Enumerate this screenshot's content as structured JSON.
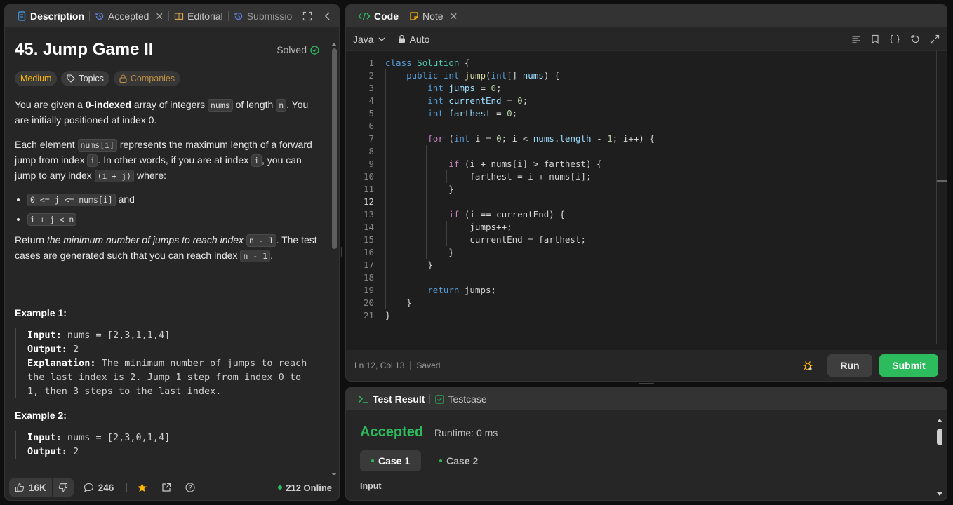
{
  "left_panel": {
    "tabs": [
      {
        "label": "Description",
        "icon": "document-icon",
        "active": true
      },
      {
        "label": "Accepted",
        "icon": "history-icon"
      },
      {
        "label": "Editorial",
        "icon": "book-icon"
      },
      {
        "label": "Submissio",
        "icon": "history-icon"
      }
    ],
    "problem": {
      "title": "45. Jump Game II",
      "status": "Solved",
      "difficulty": "Medium",
      "topics_label": "Topics",
      "companies_label": "Companies"
    },
    "description": {
      "p1_a": "You are given a ",
      "p1_bold": "0-indexed",
      "p1_b": " array of integers ",
      "p1_code1": "nums",
      "p1_c": " of length ",
      "p1_code2": "n",
      "p1_d": ". You are initially positioned at index 0.",
      "p2_a": "Each element ",
      "p2_code1": "nums[i]",
      "p2_b": " represents the maximum length of a forward jump from index ",
      "p2_code2": "i",
      "p2_c": ". In other words, if you are at index ",
      "p2_code3": "i",
      "p2_d": ", you can jump to any index ",
      "p2_code4": "(i + j)",
      "p2_e": " where:",
      "bullet1_code": "0 <= j <= nums[i]",
      "bullet1_text": " and",
      "bullet2_code": "i + j < n",
      "p3_a": "Return ",
      "p3_italic": "the minimum number of jumps to reach index",
      "p3_code1": "n - 1",
      "p3_b": ". The test cases are generated such that you can reach index ",
      "p3_code2": "n - 1",
      "p3_c": "."
    },
    "examples": [
      {
        "title": "Example 1:",
        "input_label": "Input:",
        "input": "nums = [2,3,1,1,4]",
        "output_label": "Output:",
        "output": "2",
        "explanation_label": "Explanation:",
        "explanation": "The minimum number of jumps to reach the last index is 2. Jump 1 step from index 0 to 1, then 3 steps to the last index."
      },
      {
        "title": "Example 2:",
        "input_label": "Input:",
        "input": "nums = [2,3,0,1,4]",
        "output_label": "Output:",
        "output": "2"
      }
    ],
    "footer": {
      "likes": "16K",
      "comments": "246",
      "online": "212 Online"
    }
  },
  "code_panel": {
    "tabs": [
      {
        "label": "Code",
        "icon": "code-icon",
        "active": true
      },
      {
        "label": "Note",
        "icon": "note-icon"
      }
    ],
    "language": "Java",
    "mode": "Auto",
    "current_line": 12,
    "lines": [
      "class Solution {",
      "    public int jump(int[] nums) {",
      "        int jumps = 0;",
      "        int currentEnd = 0;",
      "        int farthest = 0;",
      "",
      "        for (int i = 0; i < nums.length - 1; i++) {",
      "",
      "            if (i + nums[i] > farthest) {",
      "                farthest = i + nums[i];",
      "            }",
      "",
      "            if (i == currentEnd) {",
      "                jumps++;",
      "                currentEnd = farthest;",
      "            }",
      "        }",
      "",
      "        return jumps;",
      "    }",
      "}"
    ],
    "status": {
      "cursor": "Ln 12, Col 13",
      "saved": "Saved"
    },
    "run_label": "Run",
    "submit_label": "Submit"
  },
  "result_panel": {
    "tabs": [
      {
        "label": "Test Result",
        "icon": "terminal-icon",
        "active": true
      },
      {
        "label": "Testcase",
        "icon": "checkbox-icon"
      }
    ],
    "verdict": "Accepted",
    "runtime": "Runtime: 0 ms",
    "cases": [
      "Case 1",
      "Case 2"
    ],
    "input_label": "Input"
  },
  "colors": {
    "accent_green": "#2cbb5d",
    "medium": "#ffb800",
    "panel_bg": "#262626"
  }
}
